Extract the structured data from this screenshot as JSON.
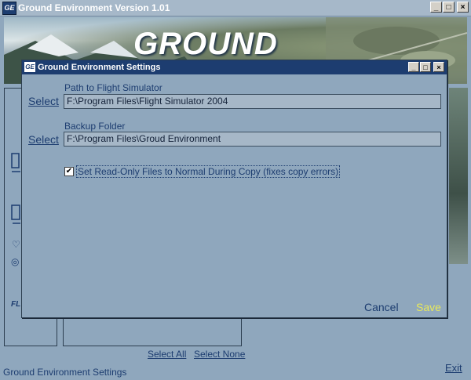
{
  "main": {
    "title": "Ground Environment Version 1.01",
    "icon_text": "GE",
    "banner_logo": "GROUND",
    "links": {
      "select_all": "Select All",
      "select_none": "Select None",
      "exit": "Exit"
    },
    "status": "Ground Environment Settings"
  },
  "dialog": {
    "title": "Ground Environment Settings",
    "icon_text": "GE",
    "path_label": "Path to Flight Simulator",
    "path_select": "Select",
    "path_value": "F:\\Program Files\\Flight Simulator 2004",
    "backup_label": "Backup Folder",
    "backup_select": "Select",
    "backup_value": "F:\\Program Files\\Groud Environment",
    "readonly_checked": true,
    "readonly_label": "Set Read-Only Files to Normal During Copy (fixes copy errors)",
    "cancel_label": "Cancel",
    "save_label": "Save"
  },
  "window_controls": {
    "minimize": "_",
    "maximize": "□",
    "close": "×"
  },
  "colors": {
    "background": "#8fa7bd",
    "dialog_titlebar": "#1d3d70",
    "link": "#1d3d70",
    "save": "#e8e85a"
  },
  "icons": [
    "app-logo-icon",
    "computer-icon",
    "monitor-icon",
    "heart-icon",
    "globe-icon",
    "checkmark-icon"
  ]
}
